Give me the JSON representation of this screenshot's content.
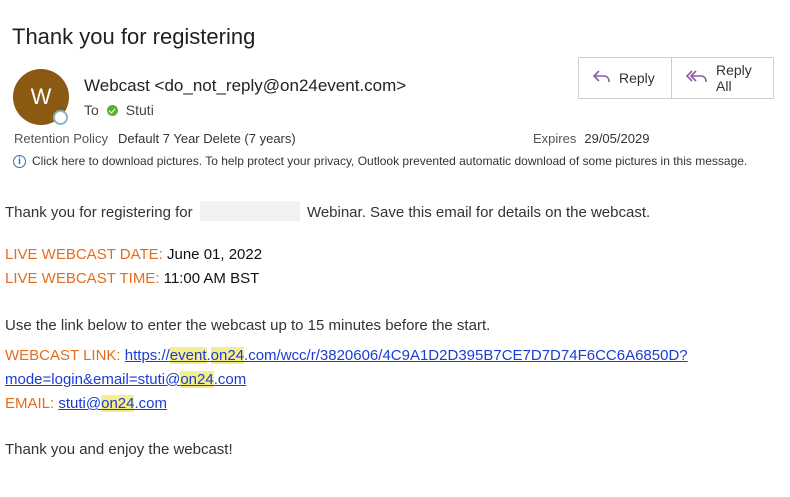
{
  "subject": "Thank you for registering",
  "sender": {
    "initial": "W",
    "name_email": "Webcast <do_not_reply@on24event.com>",
    "to_label": "To",
    "to_name": "Stuti"
  },
  "actions": {
    "reply_label": "Reply",
    "reply_all_label": "Reply All"
  },
  "retention": {
    "label": "Retention Policy",
    "value": "Default 7 Year Delete (7 years)",
    "expires_label": "Expires",
    "expires_value": "29/05/2029"
  },
  "info_bar": "Click here to download pictures. To help protect your privacy, Outlook prevented automatic download of some pictures in this message.",
  "body": {
    "intro_prefix": "Thank you for registering for",
    "intro_suffix": "Webinar. Save this email for details on the webcast.",
    "date_label": "LIVE WEBCAST DATE:",
    "date_value": "June 01, 2022",
    "time_label": "LIVE WEBCAST TIME:",
    "time_value": "11:00 AM BST",
    "instructions": "Use the link below to enter the webcast up to 15 minutes before the start.",
    "link_label": "WEBCAST LINK:",
    "link_part1": "https://",
    "link_part2": "event",
    "link_part3": ".",
    "link_part4": "on24",
    "link_part5": ".com/wcc/r/3820606/4C9A1D2D395B7CE7D7D74F6CC6A6850D?",
    "link_part6": "mode=login&email=stuti@",
    "link_part7": "on24",
    "link_part8": ".com",
    "email_label": "EMAIL:",
    "email_part1": "stuti@",
    "email_part2": "on24",
    "email_part3": ".com",
    "closing": "Thank you and enjoy the webcast!"
  },
  "colors": {
    "avatar": "#8a5a12",
    "label_orange": "#e36c1f",
    "link_blue": "#1a3dcf",
    "highlight": "#f6ee8c",
    "action_icon": "#8a5bb0"
  }
}
